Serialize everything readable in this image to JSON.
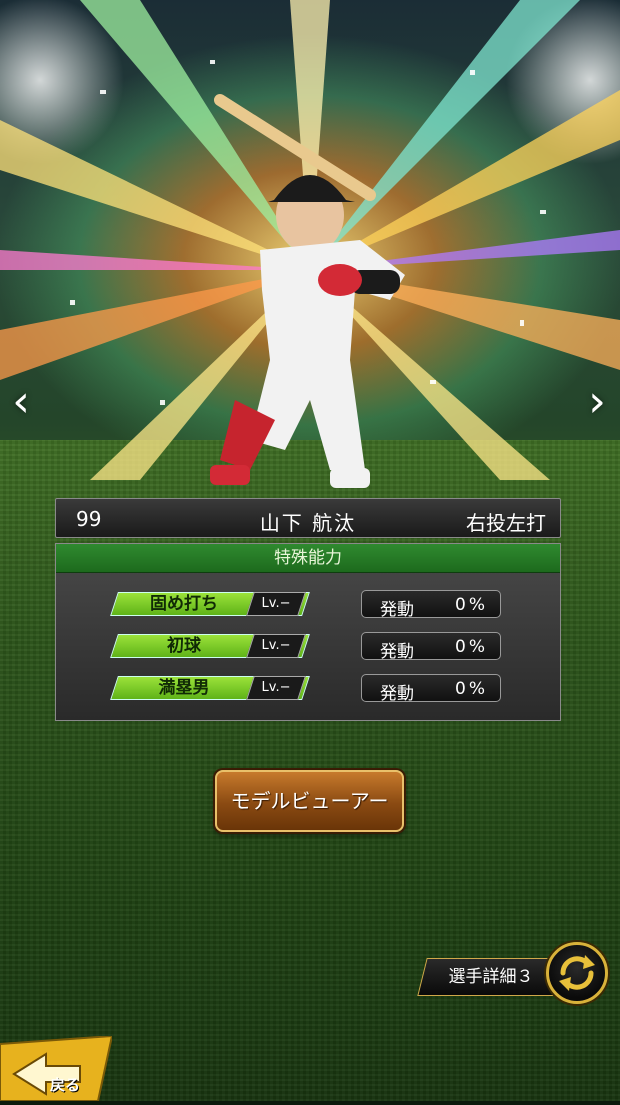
{
  "player": {
    "number": "99",
    "name": "山下 航汰",
    "handedness": "右投左打"
  },
  "abilities": {
    "header": "特殊能力",
    "items": [
      {
        "name": "固め打ち",
        "level": "Lv.−",
        "trigger_label": "発動",
        "rate": "0%"
      },
      {
        "name": "初球",
        "level": "Lv.−",
        "trigger_label": "発動",
        "rate": "0%"
      },
      {
        "name": "満塁男",
        "level": "Lv.−",
        "trigger_label": "発動",
        "rate": "0%"
      }
    ]
  },
  "buttons": {
    "model_viewer": "モデルビューアー",
    "player_detail": "選手詳細３",
    "back": "戻る"
  },
  "nav": {
    "prev_icon": "chevron-left-icon",
    "next_icon": "chevron-right-icon"
  },
  "colors": {
    "skill_green": "#7cc92a",
    "header_green": "#2a7a2a",
    "button_brown": "#8a4a12",
    "gold_accent": "#d9b23a"
  }
}
